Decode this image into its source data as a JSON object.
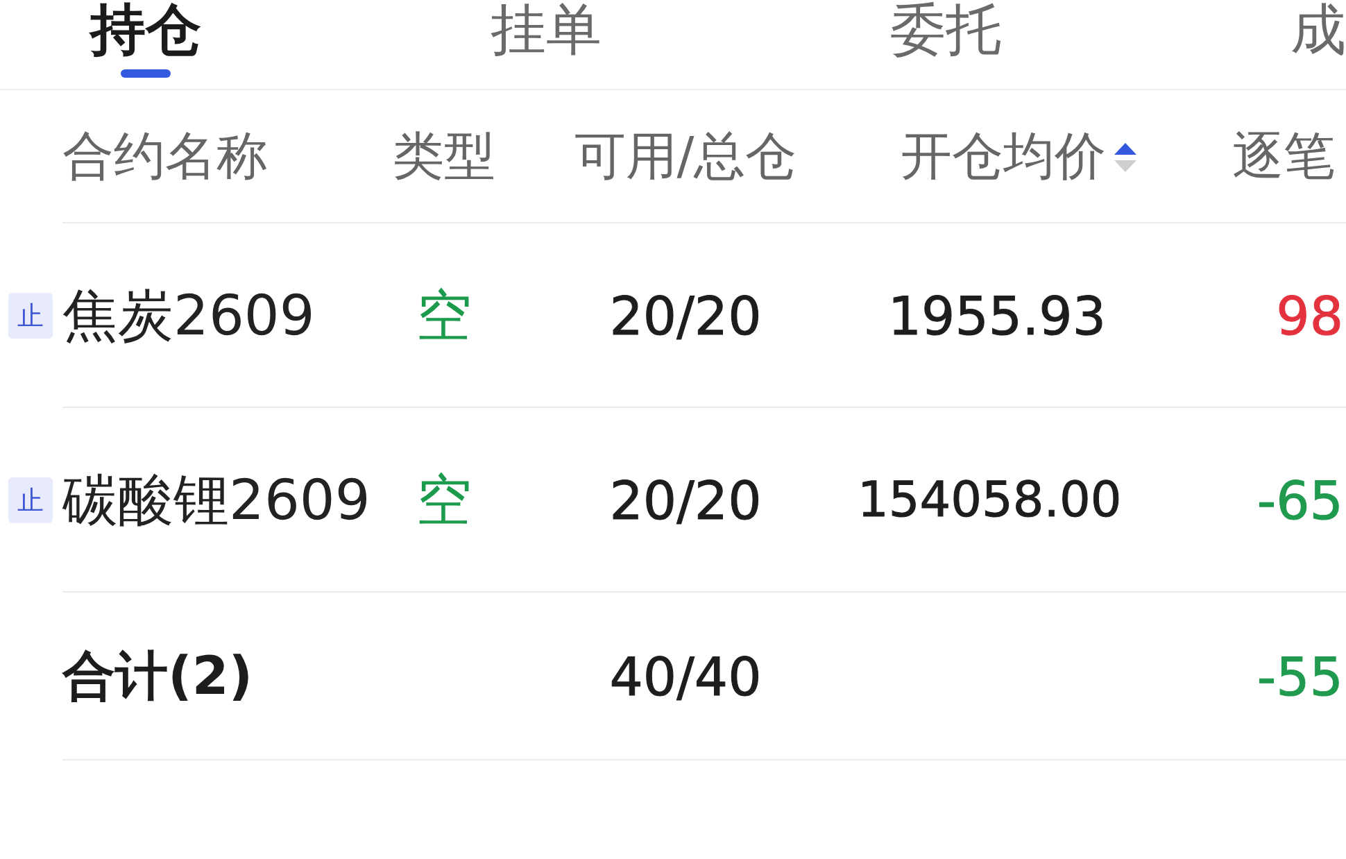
{
  "tabs": [
    {
      "label": "持仓",
      "selected": true
    },
    {
      "label": "挂单",
      "selected": false
    },
    {
      "label": "委托",
      "selected": false
    },
    {
      "label": "成",
      "selected": false
    }
  ],
  "table": {
    "columns": [
      {
        "label": "合约名称"
      },
      {
        "label": "类型"
      },
      {
        "label": "可用/总仓"
      },
      {
        "label": "开仓均价",
        "sort_ascending": true,
        "sort_descending": false
      },
      {
        "label": "逐笔"
      }
    ],
    "rows": [
      {
        "badge": "止",
        "name": "焦炭2609",
        "type": "空",
        "available_total": "20/20",
        "avg_open_price": "1955.93",
        "column_5": {
          "text": "98",
          "color": "#e3323d"
        }
      },
      {
        "badge": "止",
        "name": "碳酸锂2609",
        "type": "空",
        "available_total": "20/20",
        "avg_open_price": "154058.00",
        "column_5": {
          "text": "-65",
          "color": "#1f9a4e"
        }
      }
    ],
    "total": {
      "label": "合计(2)",
      "available_total": "40/40",
      "column_5": {
        "text": "-55",
        "color": "#1f9a4e"
      }
    }
  }
}
